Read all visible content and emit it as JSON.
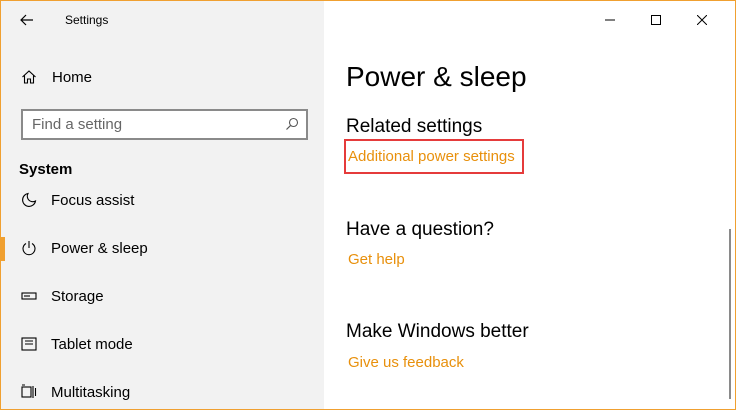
{
  "window": {
    "title": "Settings",
    "accent_color": "#f0a030",
    "link_color": "#e8900c"
  },
  "nav": {
    "home_label": "Home",
    "search_placeholder": "Find a setting",
    "section_title": "System",
    "items": [
      {
        "label": "Focus assist",
        "icon": "moon-icon",
        "selected": false
      },
      {
        "label": "Power & sleep",
        "icon": "power-icon",
        "selected": true
      },
      {
        "label": "Storage",
        "icon": "storage-icon",
        "selected": false
      },
      {
        "label": "Tablet mode",
        "icon": "tablet-mode-icon",
        "selected": false
      },
      {
        "label": "Multitasking",
        "icon": "multitasking-icon",
        "selected": false
      }
    ]
  },
  "content": {
    "page_title": "Power & sleep",
    "related_heading": "Related settings",
    "related_link": "Additional power settings",
    "question_heading": "Have a question?",
    "help_link": "Get help",
    "better_heading": "Make Windows better",
    "feedback_link": "Give us feedback"
  }
}
